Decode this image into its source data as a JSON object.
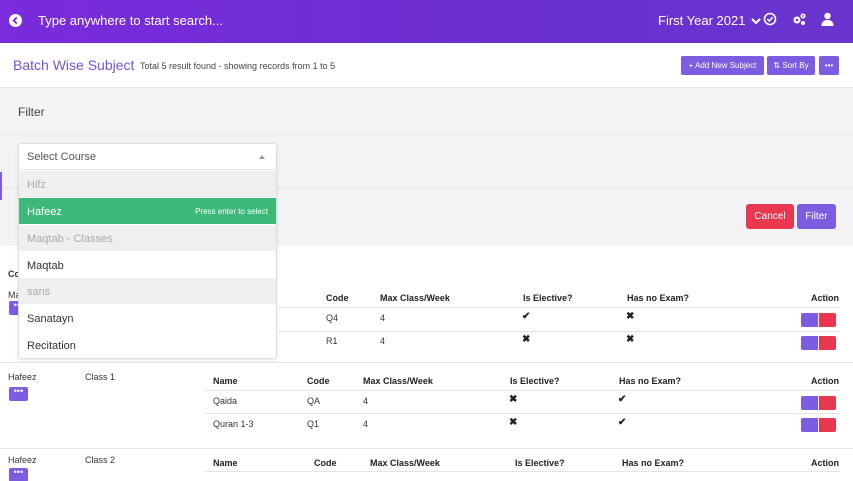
{
  "topbar": {
    "search_placeholder": "Type anywhere to start search...",
    "year": "First Year 2021"
  },
  "header": {
    "title": "Batch Wise Subject",
    "subtitle": "Total 5 result found - showing records from 1 to 5",
    "add_label": "+ Add New Subject",
    "sort_label": "⇅ Sort By",
    "more_label": "•••"
  },
  "filter": {
    "title": "Filter",
    "cancel_label": "Cancel",
    "filter_label": "Filter"
  },
  "dropdown": {
    "placeholder": "Select Course",
    "hint": "Press enter to select",
    "items": [
      {
        "label": "Hifz",
        "type": "group"
      },
      {
        "label": "Hafeez",
        "type": "selected"
      },
      {
        "label": "Maqtab - Classes",
        "type": "group"
      },
      {
        "label": "Maqtab",
        "type": "option"
      },
      {
        "label": "sans",
        "type": "group"
      },
      {
        "label": "Sanatayn",
        "type": "option"
      },
      {
        "label": "Recitation",
        "type": "option"
      }
    ]
  },
  "table": {
    "headers": {
      "name": "Name",
      "code": "Code",
      "max": "Max Class/Week",
      "elective": "Is Elective?",
      "noexam": "Has no Exam?",
      "action": "Action"
    },
    "partial_col_label": "Co",
    "partial_course": "Ma",
    "group1_rows": [
      {
        "code": "Q4",
        "max": "4",
        "elective": "✔",
        "noexam": "✖"
      },
      {
        "code": "R1",
        "max": "4",
        "elective": "✖",
        "noexam": "✖"
      }
    ],
    "group2": {
      "course": "Hafeez",
      "batch": "Class 1",
      "rows": [
        {
          "name": "Qaida",
          "code": "QA",
          "max": "4",
          "elective": "✖",
          "noexam": "✔"
        },
        {
          "name": "Quran 1-3",
          "code": "Q1",
          "max": "4",
          "elective": "✖",
          "noexam": "✔"
        }
      ]
    },
    "group3": {
      "course": "Hafeez",
      "batch": "Class 2"
    }
  },
  "colors": {
    "accent": "#7c5ce0",
    "danger": "#e8374f",
    "success": "#3cb878"
  }
}
